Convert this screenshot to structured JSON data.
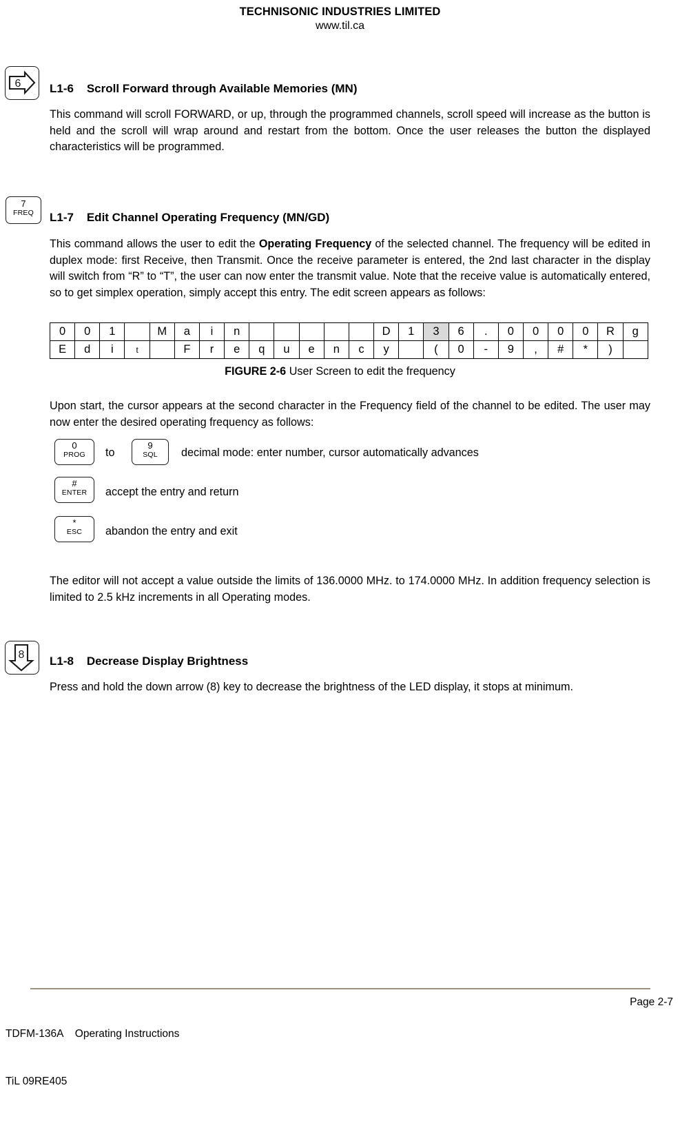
{
  "header": {
    "company": "TECHNISONIC INDUSTRIES LIMITED",
    "website": "www.til.ca"
  },
  "sections": [
    {
      "id": "L1-6",
      "number": "L1-6",
      "title": "Scroll Forward through Available Memories (MN)",
      "heading_text": "L1-6    Scroll Forward through Available Memories (MN)",
      "icon": {
        "name": "scroll-forward-key-icon",
        "digit": "6",
        "style": "right-arrow"
      },
      "body": "This command will scroll FORWARD, or up, through the programmed channels, scroll speed will increase as the button is held and the scroll will wrap around and restart from the bottom. Once the user releases the button the displayed characteristics will be programmed."
    },
    {
      "id": "L1-7",
      "number": "L1-7",
      "title": "Edit Channel Operating Frequency (MN/GD)",
      "heading_text": "L1-7    Edit Channel Operating Frequency (MN/GD)",
      "icon": {
        "name": "freq-key-icon",
        "digit": "7",
        "label": "FREQ",
        "style": "labelled"
      },
      "body_part1": "This command allows the user to edit the ",
      "body_bold": "Operating Frequency",
      "body_part2": " of the selected channel. The frequency will be edited in duplex mode: first Receive, then Transmit. Once the receive parameter is entered, the 2nd last character in the display will switch from “R” to “T”, the user can now enter the transmit value. Note that the receive value is automatically entered, so to get simplex operation, simply accept this entry. The edit screen appears as follows:"
    },
    {
      "id": "L1-8",
      "number": "L1-8",
      "title": "Decrease Display Brightness",
      "heading_text": "L1-8    Decrease Display Brightness",
      "icon": {
        "name": "decrease-brightness-key-icon",
        "digit": "8",
        "style": "down-arrow"
      },
      "body": "Press and hold the down arrow (8) key to decrease the brightness of the LED display, it stops at minimum."
    }
  ],
  "figure": {
    "caption_lead": "FIGURE 2-6",
    "caption_rest": " User Screen to edit the frequency",
    "highlight_color": "#d9d9d9",
    "columns": 24,
    "row1": [
      "0",
      "0",
      "1",
      "",
      "M",
      "a",
      "i",
      "n",
      "",
      "",
      "",
      "",
      "",
      "D",
      "1",
      "3",
      "6",
      ".",
      "0",
      "0",
      "0",
      "0",
      "R",
      "g"
    ],
    "row2": [
      "E",
      "d",
      "i",
      "t",
      "",
      "F",
      "r",
      "e",
      "q",
      "u",
      "e",
      "n",
      "c",
      "y",
      "",
      "(",
      "0",
      "-",
      "9",
      ",",
      "#",
      "*",
      ")",
      ""
    ],
    "row1_highlight_index": 15,
    "row2_small_index": 3
  },
  "instructions": {
    "upon_start": "Upon start, the cursor appears at the second character in the Frequency field of the channel to be edited. The user may now enter the desired operating frequency as follows:",
    "limits": "The editor will not accept a value outside the limits of 136.0000 MHz. to 174.0000 MHz. In addition frequency selection is limited to 2.5 kHz increments in all Operating modes."
  },
  "key_legend": [
    {
      "key_from": {
        "name": "prog-key-icon",
        "digit": "0",
        "label": "PROG"
      },
      "connector": "to",
      "key_to": {
        "name": "sql-key-icon",
        "digit": "9",
        "label": "SQL"
      },
      "description": "decimal mode: enter number, cursor automatically advances"
    },
    {
      "key_from": {
        "name": "enter-key-icon",
        "digit": "#",
        "label": "ENTER"
      },
      "connector": "",
      "key_to": null,
      "description": "accept the entry and return"
    },
    {
      "key_from": {
        "name": "esc-key-icon",
        "digit": "*",
        "label": "ESC"
      },
      "connector": "",
      "key_to": null,
      "description": "abandon the entry and exit"
    }
  ],
  "footer": {
    "model": "TDFM-136A",
    "doc_type": "Operating Instructions",
    "left_line1": "TDFM-136A    Operating Instructions",
    "left_line2": "TiL 09RE405",
    "page": "Page 2-7",
    "rule_color": "#9a9382"
  }
}
